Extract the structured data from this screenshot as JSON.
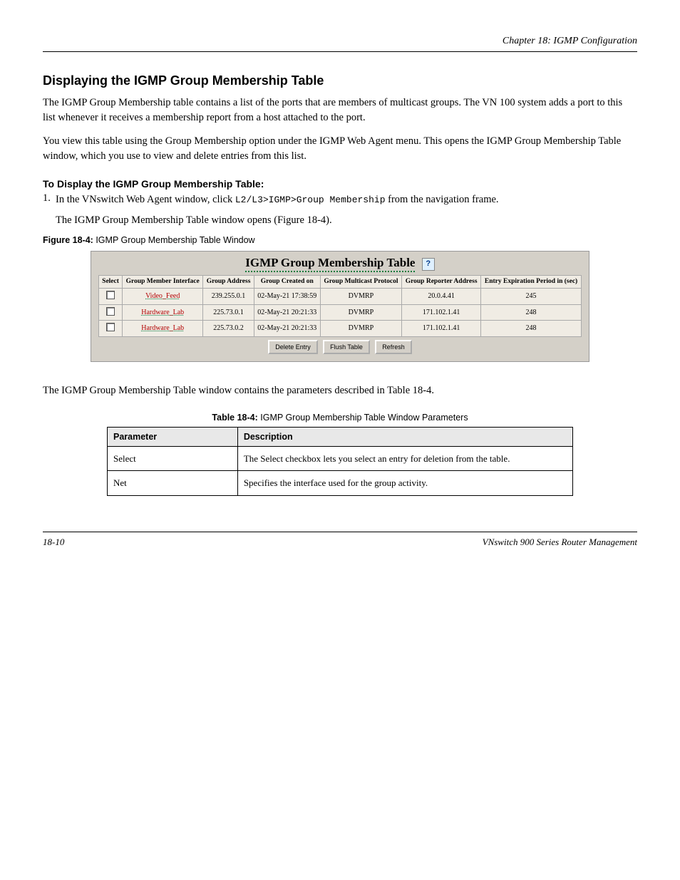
{
  "chapter_head": "Chapter 18: IGMP Configuration",
  "sec1": {
    "title": "Displaying the IGMP Group Membership Table",
    "p1": "The IGMP Group Membership table contains a list of the ports that are members of multicast groups. The VN 100 system adds a port to this list whenever it receives a membership report from a host attached to the port.",
    "p2": "You view this table using the Group Membership option under the IGMP Web Agent menu. This opens the IGMP Group Membership Table window, which you use to view and delete entries from this list."
  },
  "procedure": {
    "sub": "To Display the IGMP Group Membership Table:",
    "step_num": "1.",
    "step_a": "In the VNswitch Web Agent window, click ",
    "step_b": " from the navigation frame.",
    "step_result": "The IGMP Group Membership Table window opens (Figure 18-4).",
    "link": "L2/L3>IGMP>Group Membership"
  },
  "figure": {
    "caption_b": "Figure 18-4:",
    "caption_t": " IGMP Group Membership Table Window",
    "title": "IGMP Group Membership Table",
    "help_icon": "?",
    "headers": [
      "Select",
      "Group Member Interface",
      "Group Address",
      "Group Created on",
      "Group Multicast Protocol",
      "Group Reporter Address",
      "Entry Expiration Period in (sec)"
    ],
    "rows": [
      {
        "iface": "Video_Feed",
        "addr": "239.255.0.1",
        "created": "02-May-21 17:38:59",
        "proto": "DVMRP",
        "reporter": "20.0.4.41",
        "exp": "245"
      },
      {
        "iface": "Hardware_Lab",
        "addr": "225.73.0.1",
        "created": "02-May-21 20:21:33",
        "proto": "DVMRP",
        "reporter": "171.102.1.41",
        "exp": "248"
      },
      {
        "iface": "Hardware_Lab",
        "addr": "225.73.0.2",
        "created": "02-May-21 20:21:33",
        "proto": "DVMRP",
        "reporter": "171.102.1.41",
        "exp": "248"
      }
    ],
    "buttons": {
      "delete": "Delete Entry",
      "flush": "Flush Table",
      "refresh": "Refresh"
    }
  },
  "paragraph2": "The IGMP Group Membership Table window contains the parameters described in Table 18-4.",
  "desc_table": {
    "caption_b": "Table 18-4:",
    "caption_t": " IGMP Group Membership Table Window Parameters",
    "head1": "Parameter",
    "head2": "Description",
    "rows": [
      {
        "p": "Select",
        "d": "The Select checkbox lets you select an entry for deletion from the table."
      },
      {
        "p": "Net",
        "d": "Specifies the interface used for the group activity."
      }
    ]
  },
  "footer": {
    "left": "18-10",
    "right": "VNswitch 900 Series Router Management"
  }
}
